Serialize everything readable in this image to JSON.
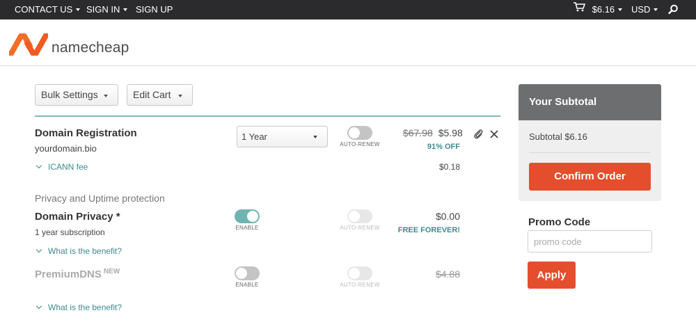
{
  "topbar": {
    "contact": "CONTACT US",
    "signin": "SIGN IN",
    "signup": "SIGN UP",
    "cart_total": "$6.16",
    "currency": "USD",
    "icons": [
      "cart-icon",
      "search-icon"
    ]
  },
  "brand": {
    "name": "namecheap",
    "accent": "#f26e28"
  },
  "toolbar": {
    "bulk_settings": "Bulk Settings",
    "edit_cart": "Edit Cart"
  },
  "domain_registration": {
    "title": "Domain Registration",
    "domain": "yourdomain.bio",
    "term": "1 Year",
    "auto_renew_label": "AUTO-RENEW",
    "auto_renew": false,
    "old_price": "$67.98",
    "price": "$5.98",
    "discount": "91% OFF",
    "icann_label": "ICANN fee",
    "icann_fee": "$0.18"
  },
  "privacy_section": {
    "heading": "Privacy and Uptime protection",
    "domain_privacy": {
      "title": "Domain Privacy *",
      "subtitle": "1 year subscription",
      "enable_label": "ENABLE",
      "enabled": true,
      "auto_renew_label": "AUTO-RENEW",
      "price": "$0.00",
      "note": "FREE FOREVER!",
      "benefit_link": "What is the benefit?"
    },
    "premium_dns": {
      "title": "PremiumDNS",
      "badge": "NEW",
      "enable_label": "ENABLE",
      "enabled": false,
      "auto_renew_label": "AUTO-RENEW",
      "price": "$4.88",
      "benefit_link": "What is the benefit?"
    }
  },
  "sidebar": {
    "subtotal_heading": "Your Subtotal",
    "subtotal_text": "Subtotal $6.16",
    "confirm_label": "Confirm Order",
    "promo_heading": "Promo Code",
    "promo_placeholder": "promo code",
    "apply_label": "Apply"
  },
  "colors": {
    "teal": "#3d8a8e",
    "orange_button": "#e44e2d",
    "topbar": "#2b2b2d"
  }
}
